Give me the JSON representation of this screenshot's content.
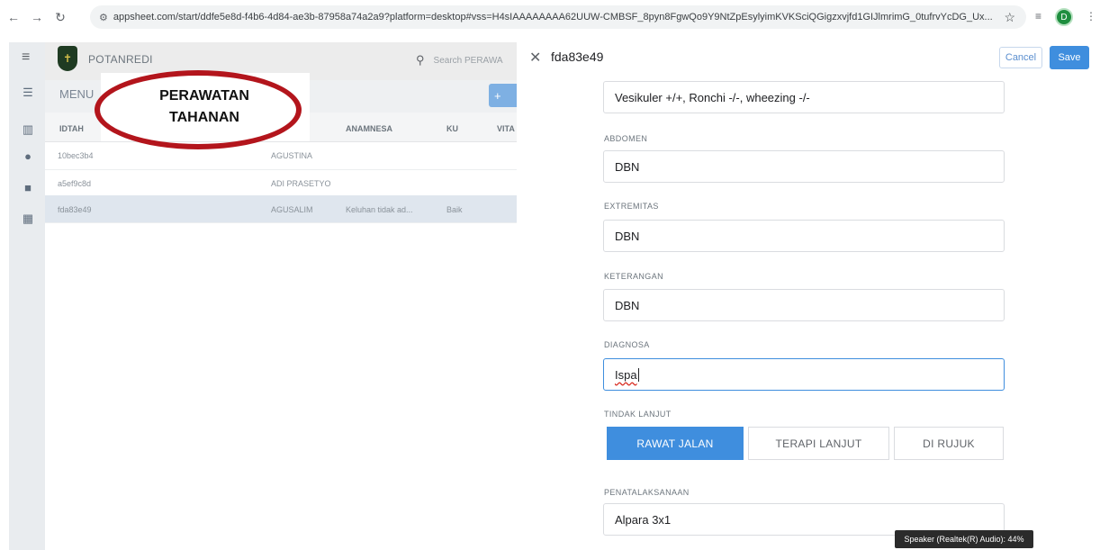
{
  "browser": {
    "url": "appsheet.com/start/ddfe5e8d-f4b6-4d84-ae3b-87958a74a2a9?platform=desktop#vss=H4sIAAAAAAAA62UUW-CMBSF_8pyn8FgwQo9Y9NtZpEsylyimKVKSciQGigzxvjfd1GIJlmrimG_0tufrvYcDG_Ux...",
    "profile_initial": "D"
  },
  "app": {
    "name": "POTANREDI",
    "search_placeholder": "Search PERAWA",
    "menu_label": "MENU",
    "add_label": "+",
    "columns": [
      "IDTAH",
      "ANAMNESA",
      "KU",
      "VITA"
    ],
    "rows": [
      {
        "id": "10bec3b4",
        "name": "AGUSTINA",
        "anamnesa": "",
        "ku": ""
      },
      {
        "id": "a5ef9c8d",
        "name": "ADI PRASETYO",
        "anamnesa": "",
        "ku": ""
      },
      {
        "id": "fda83e49",
        "name": "AGUSALIM",
        "anamnesa": "Keluhan tidak ad...",
        "ku": "Baik"
      }
    ]
  },
  "annotation": {
    "line1": "PERAWATAN",
    "line2": "TAHANAN"
  },
  "form": {
    "record_id": "fda83e49",
    "cancel_label": "Cancel",
    "save_label": "Save",
    "top_field_value": "Vesikuler +/+, Ronchi -/-, wheezing -/-",
    "abdomen": {
      "label": "ABDOMEN",
      "value": "DBN"
    },
    "extremitas": {
      "label": "EXTREMITAS",
      "value": "DBN"
    },
    "keterangan": {
      "label": "KETERANGAN",
      "value": "DBN"
    },
    "diagnosa": {
      "label": "DIAGNOSA",
      "value": "Ispa"
    },
    "tindak_lanjut": {
      "label": "TINDAK LANJUT",
      "options": [
        "RAWAT JALAN",
        "TERAPI LANJUT",
        "DI RUJUK"
      ],
      "selected": "RAWAT JALAN"
    },
    "penatalaksanaan": {
      "label": "PENATALAKSANAAN",
      "value": "Alpara 3x1"
    }
  },
  "tooltip": "Speaker (Realtek(R) Audio): 44%",
  "colors": {
    "accent": "#3f8ede",
    "annotation": "#b3151c"
  }
}
